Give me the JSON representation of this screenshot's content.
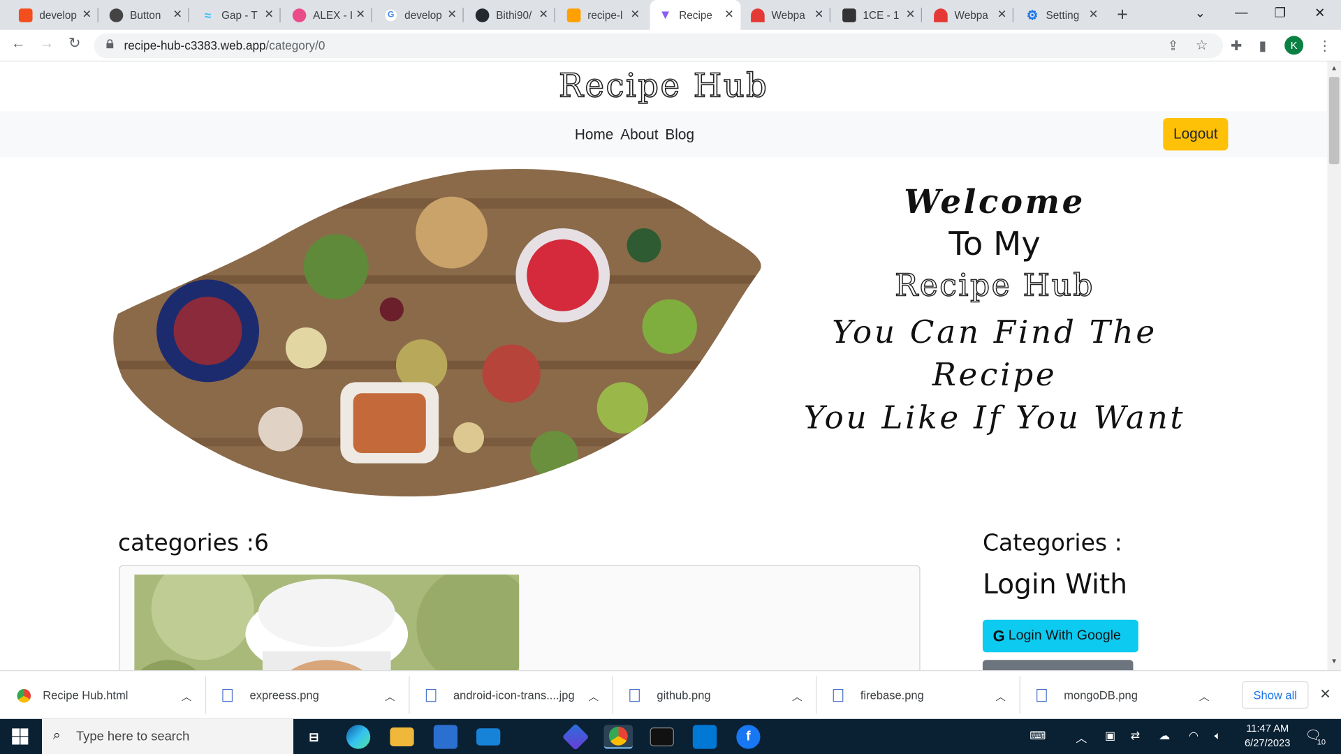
{
  "browser": {
    "tabs": [
      {
        "title": "develop",
        "icon": "figma-icon",
        "color": "#f24e1e"
      },
      {
        "title": "Button",
        "icon": "app-avatar-icon",
        "color": "#444444"
      },
      {
        "title": "Gap - T",
        "icon": "tailwind-icon",
        "color": "#38bdf8"
      },
      {
        "title": "ALEX - I",
        "icon": "dribbble-icon",
        "color": "#ea4c89"
      },
      {
        "title": "develop",
        "icon": "google-icon",
        "color": "#4285f4"
      },
      {
        "title": "Bithi90/",
        "icon": "github-icon",
        "color": "#24292f"
      },
      {
        "title": "recipe-l",
        "icon": "firebase-icon",
        "color": "#ffa000"
      },
      {
        "title": "Recipe",
        "icon": "vite-icon",
        "color": "#8b5cf6"
      },
      {
        "title": "Webpa",
        "icon": "webpage-icon",
        "color": "#e53935"
      },
      {
        "title": "1CE - 1",
        "icon": "tab-icon",
        "color": "#333333"
      },
      {
        "title": "Webpa",
        "icon": "webpage-icon",
        "color": "#e53935"
      },
      {
        "title": "Setting",
        "icon": "gear-icon",
        "color": "#1a73e8"
      }
    ],
    "active_tab": 7,
    "url_host": "recipe-hub-c3383.web.app",
    "url_path": "/category/0",
    "profile_initial": "K"
  },
  "site": {
    "title": "Recipe Hub",
    "nav": [
      "Home",
      "About",
      "Blog"
    ],
    "logout_label": "Logout",
    "hero": {
      "line1": "Welcome",
      "line2": "To My",
      "line3": "Recipe Hub",
      "line4": "You Can Find The Recipe",
      "line5": "You Like If You Want"
    },
    "category_count_label": "categories :6",
    "sidebar_title": "Categories :",
    "login_with_label": "Login With",
    "google_button_label": "Login With Google"
  },
  "downloads": {
    "items": [
      "Recipe Hub.html",
      "expreess.png",
      "android-icon-trans....jpg",
      "github.png",
      "firebase.png",
      "mongoDB.png"
    ],
    "show_all_label": "Show all"
  },
  "taskbar": {
    "search_placeholder": "Type here to search",
    "time": "11:47 AM",
    "date": "6/27/2023",
    "notification_count": "10"
  }
}
